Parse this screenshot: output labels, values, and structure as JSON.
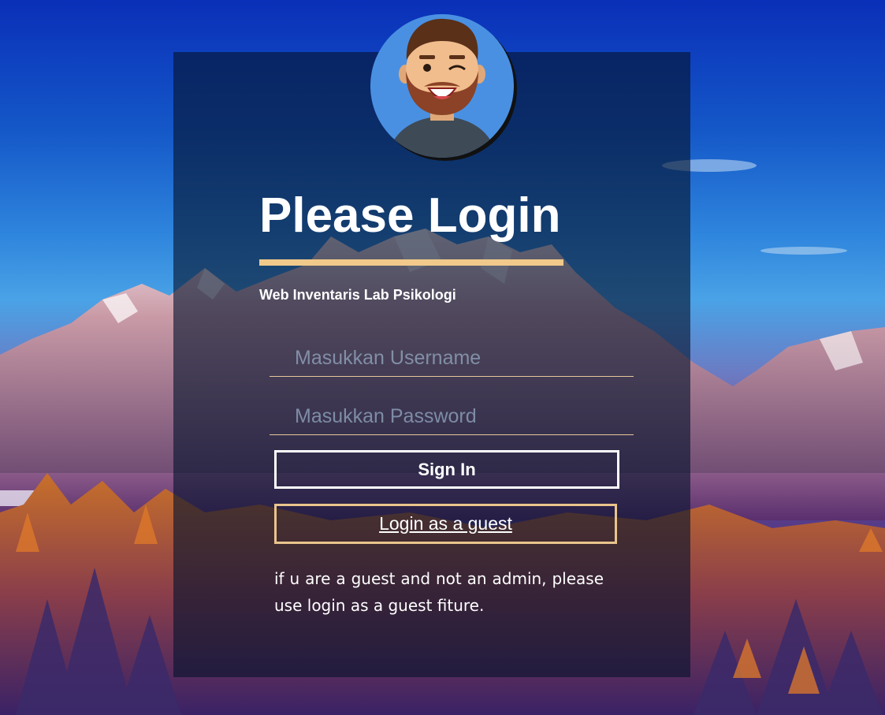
{
  "login": {
    "title": "Please Login",
    "subtitle": "Web Inventaris Lab Psikologi",
    "username_placeholder": "Masukkan Username",
    "password_placeholder": "Masukkan Password",
    "signin_label": "Sign In",
    "guest_label": "Login as a guest",
    "guest_note": "if u are a guest and not an admin, please use login as a guest fiture."
  },
  "icons": {
    "avatar": "winking-man-avatar-icon"
  },
  "colors": {
    "accent": "#f0c98b",
    "card_overlay": "rgba(5,20,45,0.62)",
    "text": "#ffffff"
  }
}
